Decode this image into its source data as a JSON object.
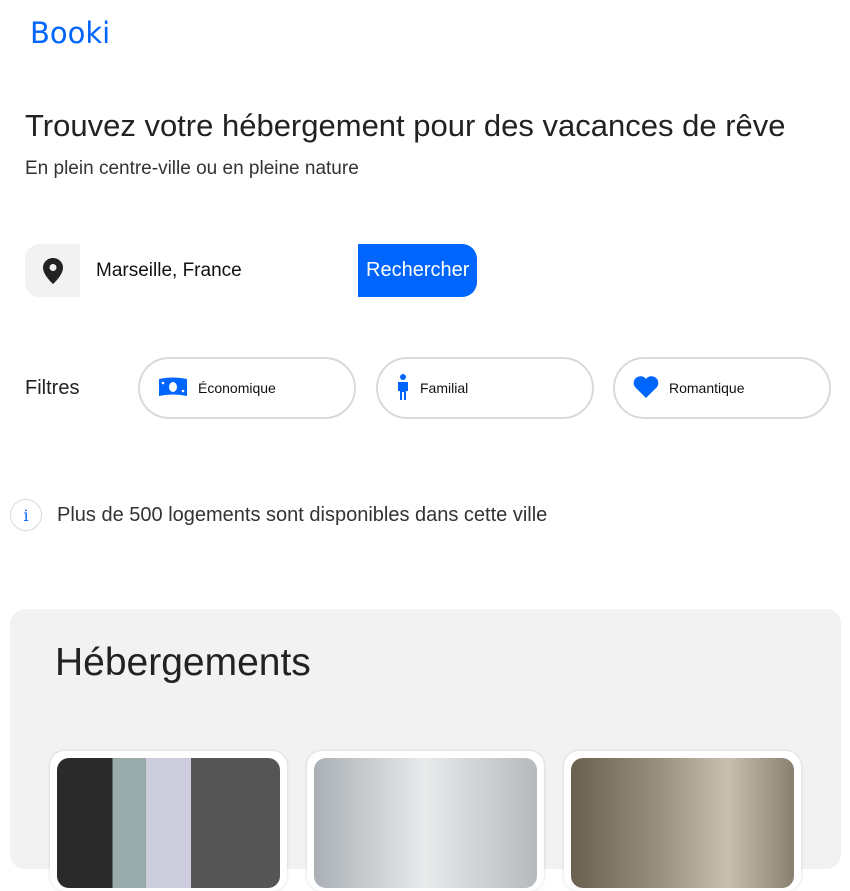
{
  "brand": "Booki",
  "hero": {
    "title": "Trouvez votre hébergement pour des vacances de rêve",
    "subtitle": "En plein centre-ville ou en pleine nature"
  },
  "search": {
    "value": "Marseille, France",
    "button": "Rechercher"
  },
  "filters": {
    "label": "Filtres",
    "items": [
      {
        "label": "Économique",
        "icon": "money-icon"
      },
      {
        "label": "Familial",
        "icon": "person-icon"
      },
      {
        "label": "Romantique",
        "icon": "heart-icon"
      }
    ]
  },
  "info": "Plus de 500 logements sont disponibles dans cette ville",
  "accommodations": {
    "title": "Hébergements"
  },
  "colors": {
    "accent": "#0065fc"
  }
}
